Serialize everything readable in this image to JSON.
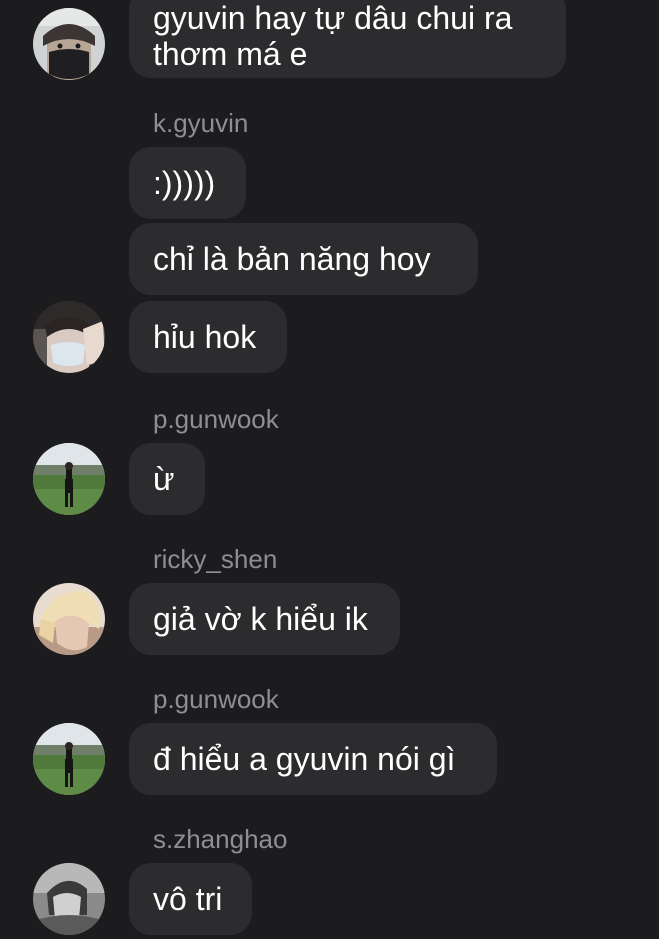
{
  "colors": {
    "background": "#1c1c1e",
    "bubble": "#2c2c2e",
    "text": "#ffffff",
    "sender": "#8e8e93"
  },
  "messages": [
    {
      "lines": [
        "gyuvin hay tự dâu chui ra",
        "thơm má e"
      ]
    },
    {
      "sender": "k.gyuvin"
    },
    {
      "text": ":)))))"
    },
    {
      "text": "chỉ là bản năng hoy"
    },
    {
      "text": "hỉu hok"
    },
    {
      "sender": "p.gunwook"
    },
    {
      "text": "ừ"
    },
    {
      "sender": "ricky_shen"
    },
    {
      "text": "giả vờ k hiểu ik"
    },
    {
      "sender": "p.gunwook"
    },
    {
      "text": "đ hiểu a gyuvin nói gì"
    },
    {
      "sender": "s.zhanghao"
    },
    {
      "text": "vô tri"
    }
  ],
  "avatars": [
    {
      "icon": "masked-face-avatar-icon"
    },
    {
      "icon": "hand-face-avatar-icon"
    },
    {
      "icon": "soccer-field-avatar-icon"
    },
    {
      "icon": "blond-profile-avatar-icon"
    },
    {
      "icon": "soccer-field-avatar-icon"
    },
    {
      "icon": "monochrome-portrait-avatar-icon"
    }
  ]
}
